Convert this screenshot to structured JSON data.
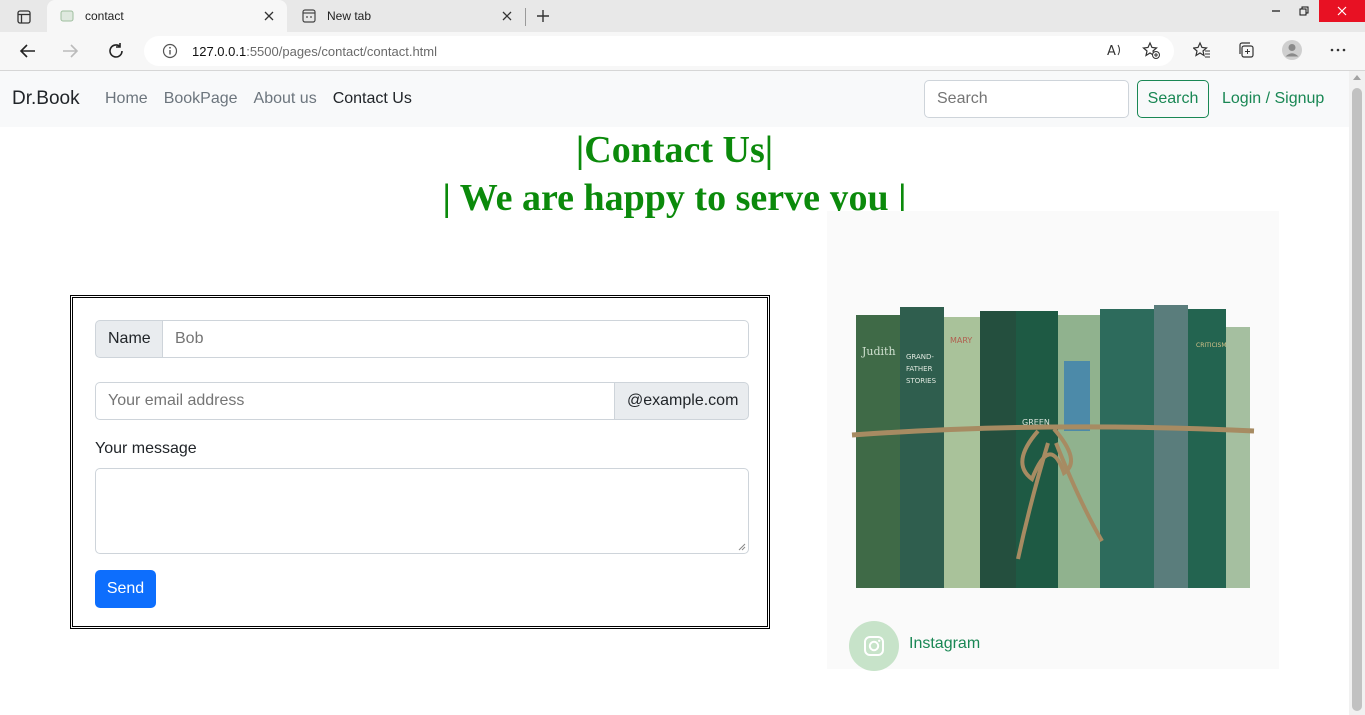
{
  "browser": {
    "tabs": [
      {
        "title": "contact",
        "active": true
      },
      {
        "title": "New tab",
        "active": false
      }
    ],
    "url_host": "127.0.0.1",
    "url_path": ":5500/pages/contact/contact.html"
  },
  "navbar": {
    "brand": "Dr.Book",
    "links": [
      {
        "label": "Home"
      },
      {
        "label": "BookPage"
      },
      {
        "label": "About us"
      },
      {
        "label": "Contact Us"
      }
    ],
    "search_placeholder": "Search",
    "search_button": "Search",
    "login": "Login / Signup"
  },
  "heading": {
    "line1": "|Contact Us|",
    "line2": "| We are happy to serve you |"
  },
  "form": {
    "name_label": "Name",
    "name_placeholder": "Bob",
    "email_placeholder": "Your email address",
    "email_suffix": "@example.com",
    "message_label": "Your message",
    "send_label": "Send"
  },
  "side": {
    "instagram_label": "Instagram"
  },
  "colors": {
    "heading_green": "#0b8a0b",
    "success": "#198754",
    "primary": "#0d6efd"
  }
}
